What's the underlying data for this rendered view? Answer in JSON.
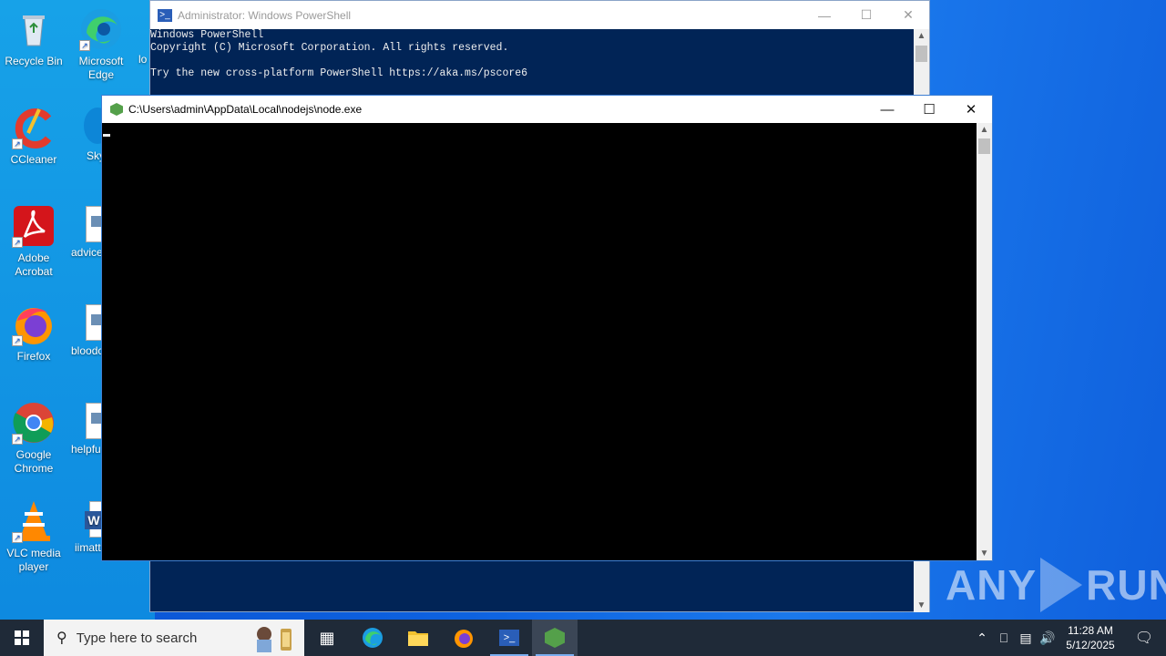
{
  "desktop": {
    "icons": [
      {
        "label": "Recycle Bin"
      },
      {
        "label": "Microsoft Edge"
      },
      {
        "label": "CCleaner"
      },
      {
        "label": "Adobe Acrobat"
      },
      {
        "label": "Firefox"
      },
      {
        "label": "Google Chrome"
      },
      {
        "label": "VLC media player"
      }
    ],
    "partial_icons": [
      {
        "label": "lo"
      },
      {
        "label": "Sky"
      },
      {
        "label": "advice"
      },
      {
        "label": "bloodc"
      },
      {
        "label": "helpfu"
      },
      {
        "label": "iimatt"
      }
    ]
  },
  "powershell": {
    "title": "Administrator: Windows PowerShell",
    "lines": [
      "Windows PowerShell",
      "Copyright (C) Microsoft Corporation. All rights reserved.",
      "",
      "Try the new cross-platform PowerShell https://aka.ms/pscore6"
    ],
    "controls": {
      "minimize": "—",
      "maximize": "☐",
      "close": "✕"
    }
  },
  "node": {
    "title": "C:\\Users\\admin\\AppData\\Local\\nodejs\\node.exe",
    "controls": {
      "minimize": "—",
      "maximize": "☐",
      "close": "✕"
    }
  },
  "watermark": {
    "left": "ANY",
    "right": "RUN"
  },
  "taskbar": {
    "search_placeholder": "Type here to search",
    "apps": [
      "task-view",
      "edge",
      "file-explorer",
      "firefox",
      "powershell",
      "node"
    ],
    "clock_time": "11:28 AM",
    "clock_date": "5/12/2025"
  },
  "colors": {
    "powershell_bg": "#012456",
    "taskbar_bg": "#1f2a38",
    "desktop_blue": "#0d62e0"
  }
}
